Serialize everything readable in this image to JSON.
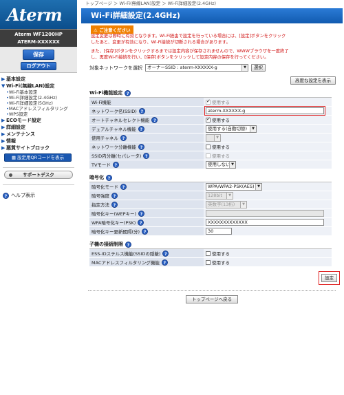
{
  "sidebar": {
    "logo": "Aterm",
    "model": "Aterm WF1200HP",
    "device": "ATERM-XXXXXX",
    "save_label": "保存",
    "logout_label": "ログアウト",
    "nav": [
      {
        "label": "基本設定"
      },
      {
        "label": "Wi-Fi(無線LAN)設定"
      }
    ],
    "wifi_sub": [
      "Wi-Fi基本設定",
      "Wi-Fi詳細設定(2.4GHz)",
      "Wi-Fi詳細設定(5GHz)",
      "MACアドレスフィルタリング",
      "WPS設定"
    ],
    "nav2": [
      {
        "label": "ECOモード設定"
      },
      {
        "label": "詳細設定"
      },
      {
        "label": "メンテナンス"
      },
      {
        "label": "情報"
      },
      {
        "label": "悪質サイトブロック"
      }
    ],
    "qr_label": "設定用QRコードを表示",
    "support_label": "サポートデスク",
    "help_label": "ヘルプ表示"
  },
  "main": {
    "breadcrumb": "トップページ ＞ Wi-Fi(無線LAN)設定 ＞ Wi-Fi詳細設定(2.4GHz)",
    "title": "Wi-Fi詳細設定(2.4GHz)",
    "notice_label": "ご注意ください",
    "notice_1a": "設定変更は即時に有効となります。Wi-Fi経由で設定を行っている場合には、[設定]ボタンをクリック",
    "notice_1b": "したあと、変更が有効になり、Wi-Fi接続が切断される場合があります。",
    "notice_2a": "また、[保存]ボタンをクリックするまでは設定内容が保存されませんので、WWWブラウザを一度終了",
    "notice_2b": "し、再度Wi-Fi接続を行い、[保存]ボタンをクリックして設定内容の保存を行ってください。",
    "target_label": "対象ネットワークを選択",
    "target_value": "オーナーSSID : aterm-XXXXXX-g",
    "select_btn": "選択",
    "advanced_btn": "高度な設定を表示",
    "wifi_section": {
      "title": "Wi-Fi機能設定",
      "rows": {
        "wifi_func": "Wi-Fi機能",
        "wifi_func_val": "使用する",
        "ssid": "ネットワーク名(SSID)",
        "ssid_val": "aterm-XXXXXX-g",
        "auto_ch": "オートチャネルセレクト機能",
        "auto_ch_val": "使用する",
        "dual_ch": "デュアルチャネル機能",
        "dual_ch_val": "使用する(自動切替)",
        "channel": "使用チャネル",
        "channel_val": "",
        "net_sep": "ネットワーク分離機能",
        "net_sep_val": "使用する",
        "ssid_sep": "SSID内分離(セパレータ)",
        "ssid_sep_val": "使用する",
        "tv": "TVモード",
        "tv_val": "使用しない"
      }
    },
    "enc_section": {
      "title": "暗号化",
      "rows": {
        "mode": "暗号化モード",
        "mode_val": "WPA/WPA2-PSK(AES)",
        "strength": "暗号強度",
        "strength_val": "128bit",
        "method": "指定方法",
        "method_val": "英数字(13桁)",
        "wep": "暗号化キー(WEPキー)",
        "wep_val": "",
        "psk": "WPA暗号化キー(PSK)",
        "psk_val": "XXXXXXXXXXXXX",
        "interval": "暗号化キー更新間隔(分)",
        "interval_val": "30"
      }
    },
    "limit_section": {
      "title": "子機の接続制限",
      "rows": {
        "essid": "ESS-IDステルス機能(SSIDの隠蔽)",
        "essid_val": "使用する",
        "mac": "MACアドレスフィルタリング機能",
        "mac_val": "使用する"
      }
    },
    "set_btn": "設定",
    "top_btn": "トップページへ戻る"
  },
  "colors": {
    "accent": "#115bb0",
    "warning": "#d01010",
    "notice": "#f08000"
  }
}
